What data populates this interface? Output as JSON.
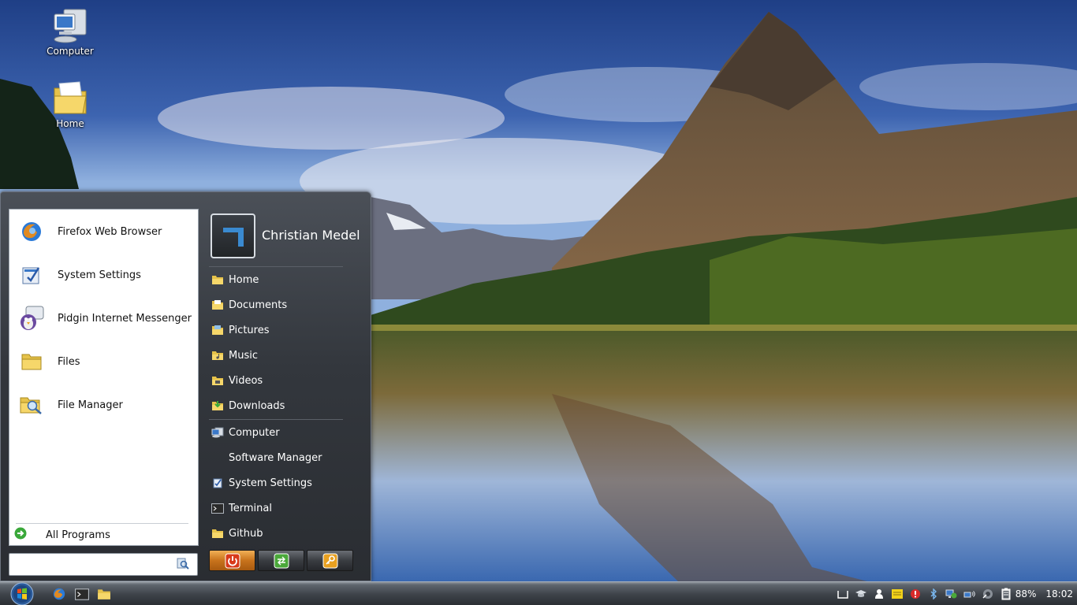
{
  "desktop": {
    "icons": [
      {
        "label": "Computer",
        "icon": "computer-icon"
      },
      {
        "label": "Home",
        "icon": "home-folder-icon"
      }
    ]
  },
  "start_menu": {
    "programs": [
      {
        "label": "Firefox Web Browser",
        "icon": "firefox-icon"
      },
      {
        "label": "System Settings",
        "icon": "settings-icon"
      },
      {
        "label": "Pidgin Internet Messenger",
        "icon": "pidgin-icon"
      },
      {
        "label": "Files",
        "icon": "folder-icon"
      },
      {
        "label": "File Manager",
        "icon": "file-manager-icon"
      }
    ],
    "all_programs_label": "All Programs",
    "search": {
      "value": "",
      "placeholder": ""
    },
    "user_name": "Christian Medel",
    "places": [
      {
        "label": "Home",
        "icon": "home-folder-icon"
      },
      {
        "label": "Documents",
        "icon": "documents-folder-icon"
      },
      {
        "label": "Pictures",
        "icon": "pictures-folder-icon"
      },
      {
        "label": "Music",
        "icon": "music-folder-icon"
      },
      {
        "label": "Videos",
        "icon": "videos-folder-icon"
      },
      {
        "label": "Downloads",
        "icon": "downloads-folder-icon"
      },
      {
        "label": "Computer",
        "icon": "computer-icon"
      },
      {
        "label": "Software Manager",
        "icon": ""
      },
      {
        "label": "System Settings",
        "icon": "settings-icon"
      },
      {
        "label": "Terminal",
        "icon": "terminal-icon"
      },
      {
        "label": "Github",
        "icon": "folder-icon"
      }
    ],
    "buttons": [
      {
        "name": "power",
        "icon": "power-icon"
      },
      {
        "name": "switch-user",
        "icon": "switch-user-icon"
      },
      {
        "name": "lock",
        "icon": "lock-icon"
      }
    ]
  },
  "taskbar": {
    "launchers": [
      "firefox-icon",
      "terminal-icon",
      "folder-icon"
    ],
    "tray": {
      "battery": "88%",
      "clock": "18:02"
    }
  },
  "colors": {
    "menu_bg": "#33373d",
    "power_button": "#c8731c",
    "taskbar": "#3d4249"
  }
}
